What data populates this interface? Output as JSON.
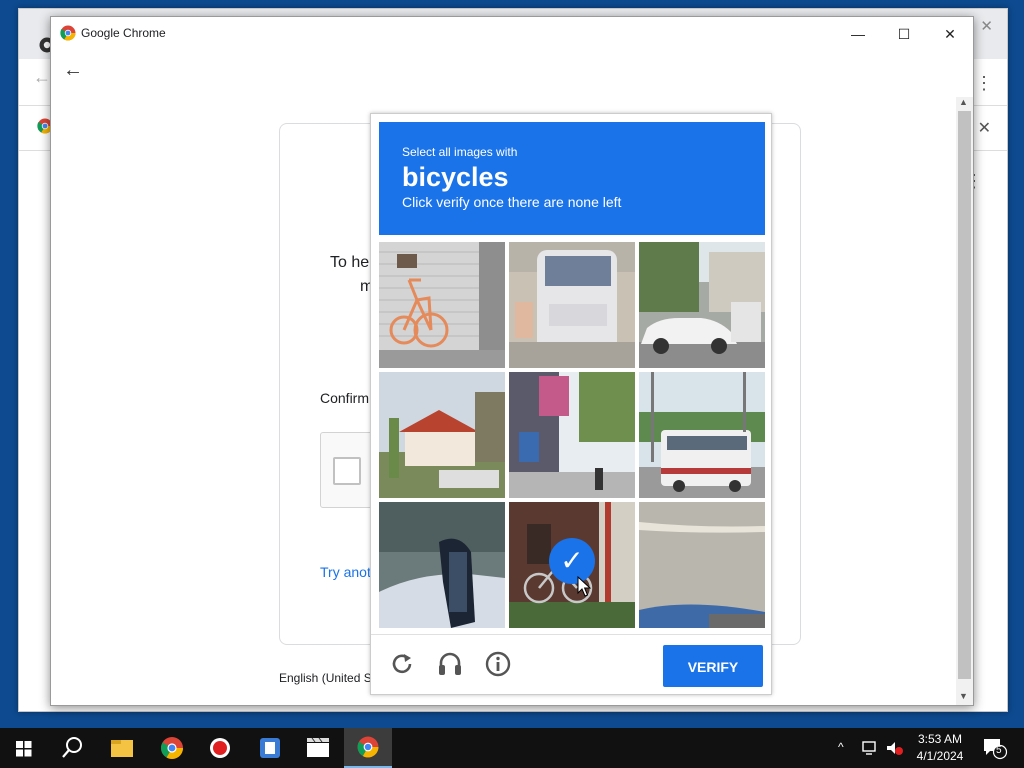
{
  "window": {
    "title": "Google Chrome",
    "minimize_symbol": "—",
    "maximize_symbol": "☐",
    "close_symbol": "✕",
    "back_symbol": "←"
  },
  "page": {
    "text_line1": "To he",
    "text_line2": "m",
    "confirm_label": "Confirm",
    "try_link": "Try anot",
    "language": "English (United S"
  },
  "challenge": {
    "select_text": "Select all images with",
    "object": "bicycles",
    "instruction": "Click verify once there are none left",
    "verify_label": "VERIFY",
    "selected_mark": "✓",
    "tiles": [
      {
        "id": "tile-1",
        "subject": "orange bicycle by shutter",
        "selected": false
      },
      {
        "id": "tile-2",
        "subject": "back of white bus",
        "selected": false
      },
      {
        "id": "tile-3",
        "subject": "white car on street",
        "selected": false
      },
      {
        "id": "tile-4",
        "subject": "red roof house",
        "selected": false
      },
      {
        "id": "tile-5",
        "subject": "shopping street",
        "selected": false
      },
      {
        "id": "tile-6",
        "subject": "articulated bus",
        "selected": false
      },
      {
        "id": "tile-7",
        "subject": "car mirror",
        "selected": false
      },
      {
        "id": "tile-8",
        "subject": "bicycle in doorway",
        "selected": true
      },
      {
        "id": "tile-9",
        "subject": "road with car",
        "selected": false
      }
    ],
    "footer_icons": [
      "reload-icon",
      "audio-icon",
      "info-icon"
    ]
  },
  "taskbar": {
    "apps": [
      "start-icon",
      "search-icon",
      "file-explorer-icon",
      "chrome-icon",
      "record-icon",
      "app-icon",
      "media-icon",
      "chrome-active-icon"
    ],
    "time": "3:53 AM",
    "date": "4/1/2024",
    "notification_count": "5",
    "tray_chevron": "^"
  },
  "colors": {
    "accent": "#1a73e8",
    "taskbar": "#111111"
  }
}
